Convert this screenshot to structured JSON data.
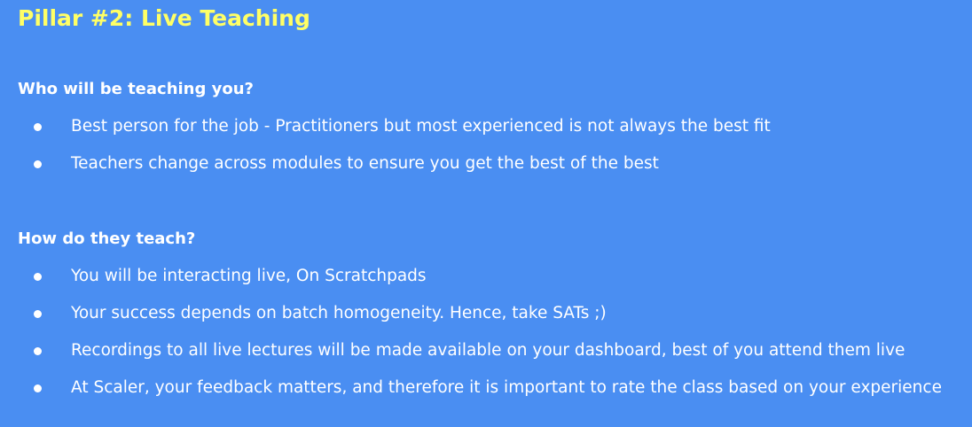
{
  "slide": {
    "title": "Pillar #2: Live Teaching",
    "sections": [
      {
        "heading": "Who will be teaching you?",
        "bullets": [
          "Best person for the job - Practitioners but most experienced is not always the best fit",
          "Teachers change across modules to ensure you get the best of the best"
        ]
      },
      {
        "heading": "How do they teach?",
        "bullets": [
          "You will be interacting live, On Scratchpads",
          "Your success depends on batch homogeneity. Hence, take SATs ;)",
          "Recordings to all live lectures will be made available on your dashboard, best of you attend them live",
          "At Scaler, your feedback matters, and therefore it is important to rate the class based on your experience"
        ]
      }
    ]
  },
  "colors": {
    "background": "#4a8ef2",
    "title": "#ffff66",
    "text": "#ffffff"
  }
}
